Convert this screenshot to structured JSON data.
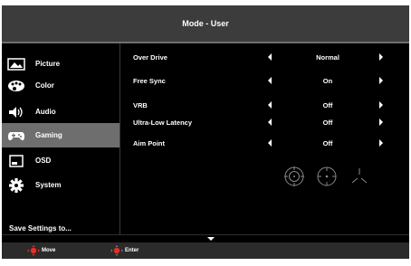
{
  "header": {
    "title": "Mode - User"
  },
  "sidebar": {
    "items": [
      {
        "label": "Picture",
        "icon": "picture-icon",
        "active": false
      },
      {
        "label": "Color",
        "icon": "palette-icon",
        "active": false
      },
      {
        "label": "Audio",
        "icon": "speaker-icon",
        "active": false
      },
      {
        "label": "Gaming",
        "icon": "gamepad-icon",
        "active": true
      },
      {
        "label": "OSD",
        "icon": "osd-icon",
        "active": false
      },
      {
        "label": "System",
        "icon": "gear-icon",
        "active": false
      }
    ],
    "save_label": "Save Settings to..."
  },
  "settings": [
    {
      "label": "Over Drive",
      "value": "Normal"
    },
    {
      "label": "Free Sync",
      "value": "On"
    },
    {
      "label": "VRB",
      "value": "Off"
    },
    {
      "label": "Ultra-Low Latency",
      "value": "Off"
    },
    {
      "label": "Aim Point",
      "value": "Off"
    }
  ],
  "aim_point_options": [
    "crosshair-circle-icon",
    "crosshair-dot-icon",
    "crosshair-tri-icon"
  ],
  "footer": {
    "move_label": "Move",
    "enter_label": "Enter"
  },
  "colors": {
    "background": "#000000",
    "titlebar": "#3c3c3c",
    "active_item": "#6e6e6e",
    "dpad_red": "#e0302a"
  }
}
